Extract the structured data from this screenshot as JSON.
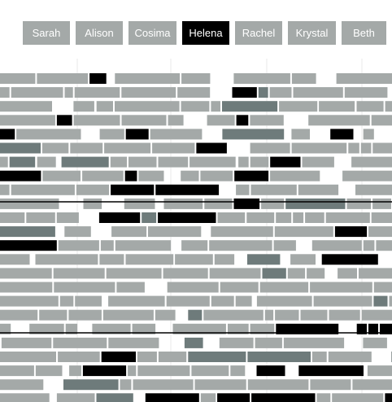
{
  "nav": {
    "items": [
      {
        "label": "Sarah",
        "active": false
      },
      {
        "label": "Alison",
        "active": false
      },
      {
        "label": "Cosima",
        "active": false
      },
      {
        "label": "Helena",
        "active": true
      },
      {
        "label": "Rachel",
        "active": false
      },
      {
        "label": "Krystal",
        "active": false
      },
      {
        "label": "Beth",
        "active": false
      }
    ]
  },
  "colors": {
    "background": "#ffffff",
    "button": "#a4a9a8",
    "button_active": "#000000",
    "button_text": "#ffffff",
    "bar": "#a4a9a8",
    "bar_other": "#6e7b7b",
    "bar_selected": "#000000",
    "gridline": "#eaeaea",
    "divider": "#000000"
  }
}
